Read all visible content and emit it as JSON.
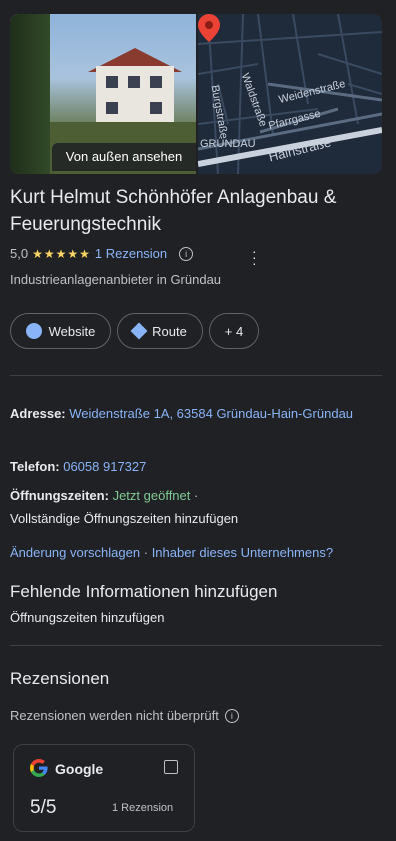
{
  "photo": {
    "label": "Von außen ansehen"
  },
  "map": {
    "streets": [
      "Burgstraße",
      "Waldstraße",
      "Weidenstraße",
      "Pfarrgasse",
      "Hainstraße",
      "GRÜNDAU"
    ]
  },
  "business": {
    "name": "Kurt Helmut Schönhöfer Anlagenbau & Feuerungstechnik",
    "rating": "5,0",
    "stars": "★★★★★",
    "reviews_link": "1 Rezension",
    "category": "Industrieanlagenanbieter in Gründau"
  },
  "actions": {
    "website": "Website",
    "route": "Route",
    "more": "+ 4"
  },
  "details": {
    "address_label": "Adresse:",
    "address_value": "Weidenstraße 1A, 63584 Gründau-Hain-Gründau",
    "phone_label": "Telefon:",
    "phone_value": "06058 917327",
    "hours_label": "Öffnungszeiten:",
    "hours_status": "Jetzt geöffnet",
    "hours_sep": "·",
    "hours_add": "Vollständige Öffnungszeiten hinzufügen",
    "suggest": "Änderung vorschlagen",
    "link_sep": "·",
    "owner": "Inhaber dieses Unternehmens?"
  },
  "missing": {
    "title": "Fehlende Informationen hinzufügen",
    "hours_link": "Öffnungszeiten hinzufügen"
  },
  "reviews": {
    "title": "Rezensionen",
    "note": "Rezensionen werden nicht überprüft",
    "source": "Google",
    "score": "5/5",
    "count": "1 Rezension"
  },
  "colors": {
    "background": "#202124",
    "link": "#8ab4f8",
    "star": "#fdd663",
    "open": "#81c995",
    "pin": "#ea4335"
  }
}
